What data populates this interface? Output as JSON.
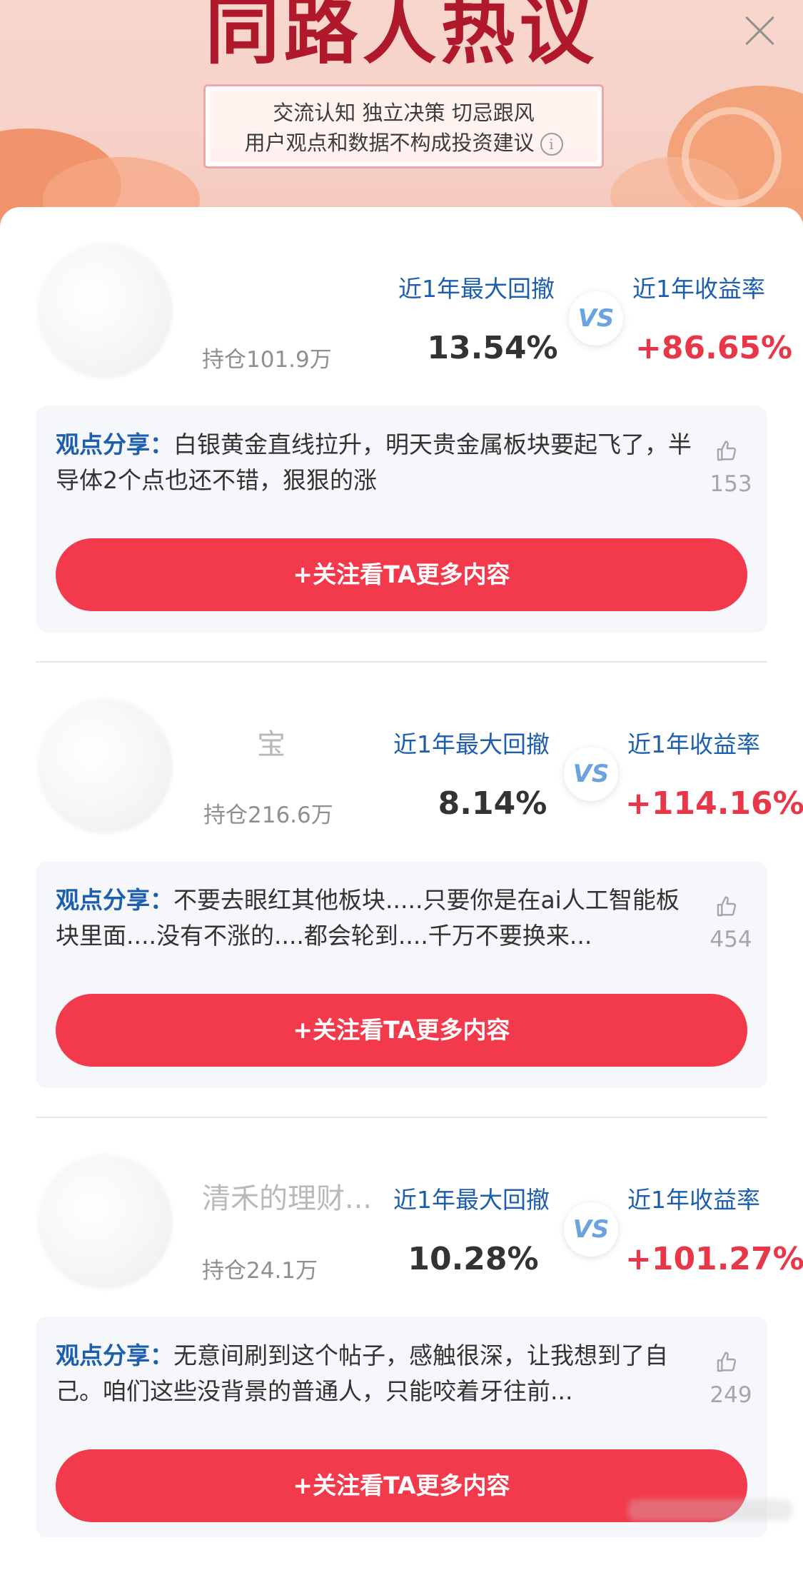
{
  "header": {
    "title": "同路人热议",
    "notice_line1": "交流认知  独立决策  切忌跟风",
    "notice_line2": "用户观点和数据不构成投资建议",
    "info_icon": "i"
  },
  "labels": {
    "drawdown": "近1年最大回撤",
    "return": "近1年收益率",
    "vs": "VS",
    "opinion_prefix": "观点分享：",
    "follow_button": "+关注看TA更多内容"
  },
  "cards": [
    {
      "username": "",
      "holdings": "持仓101.9万",
      "drawdown": "13.54%",
      "return": "+86.65%",
      "opinion": "白银黄金直线拉升，明天贵金属板块要起飞了，半导体2个点也还不错，狠狠的涨",
      "likes": "153"
    },
    {
      "username": "宝",
      "holdings": "持仓216.6万",
      "drawdown": "8.14%",
      "return": "+114.16%",
      "opinion": "不要去眼红其他板块.....只要你是在ai人工智能板块里面....没有不涨的....都会轮到....千万不要换来...",
      "likes": "454"
    },
    {
      "username": "清禾的理财...",
      "holdings": "持仓24.1万",
      "drawdown": "10.28%",
      "return": "+101.27%",
      "opinion": "无意间刷到这个帖子，感触很深，让我想到了自己。咱们这些没背景的普通人，只能咬着牙往前...",
      "likes": "249"
    }
  ],
  "colors": {
    "accent_red": "#f23a4c",
    "return_red": "#e9374a",
    "label_blue": "#1d5fad",
    "title_red": "#b0182c"
  }
}
